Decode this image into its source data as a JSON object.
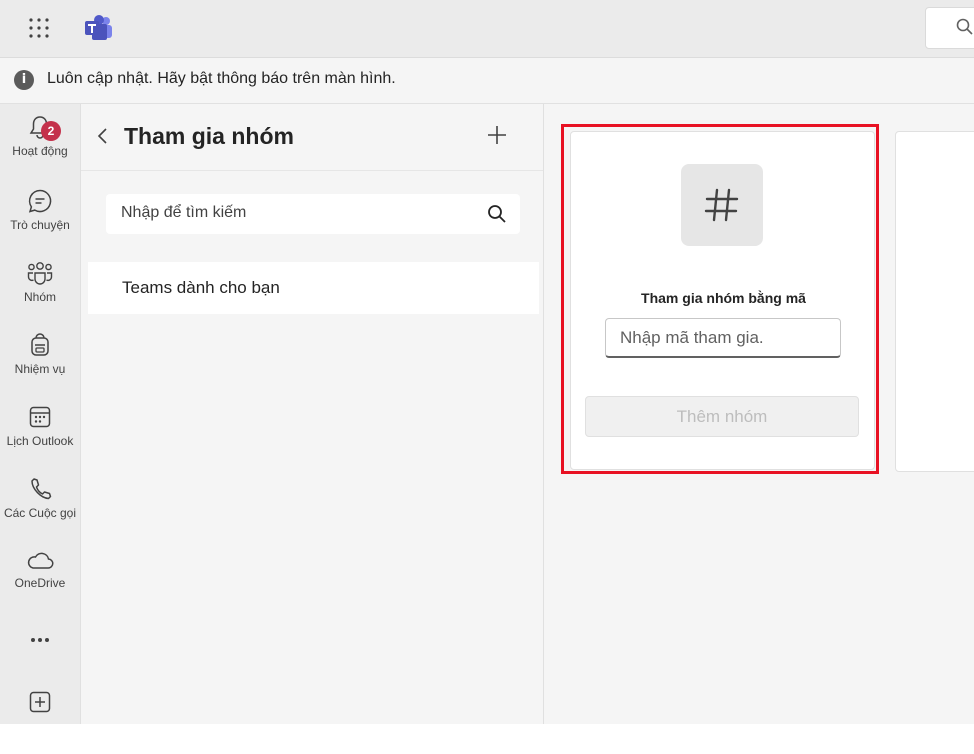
{
  "banner": {
    "text": "Luôn cập nhật. Hãy bật thông báo trên màn hình."
  },
  "rail": {
    "items": [
      {
        "label": "Hoạt động",
        "icon": "bell-icon",
        "badge": "2"
      },
      {
        "label": "Trò chuyện",
        "icon": "chat-icon"
      },
      {
        "label": "Nhóm",
        "icon": "teams-icon"
      },
      {
        "label": "Nhiệm vụ",
        "icon": "tasks-icon"
      },
      {
        "label": "Lịch Outlook",
        "icon": "calendar-icon"
      },
      {
        "label": "Các Cuộc gọi",
        "icon": "phone-icon"
      },
      {
        "label": "OneDrive",
        "icon": "cloud-icon"
      }
    ],
    "more_icon": "more-icon",
    "apps_icon": "add-apps-icon"
  },
  "list_pane": {
    "title": "Tham gia nhóm",
    "search_placeholder": "Nhập để tìm kiếm",
    "rows": [
      {
        "label": "Teams dành cho bạn"
      }
    ]
  },
  "join_card": {
    "title": "Tham gia nhóm bằng mã",
    "code_placeholder": "Nhập mã tham gia.",
    "button_label": "Thêm nhóm",
    "highlight_color": "#e81123"
  },
  "colors": {
    "brand": "#4b53bc",
    "badge": "#c4314b"
  }
}
